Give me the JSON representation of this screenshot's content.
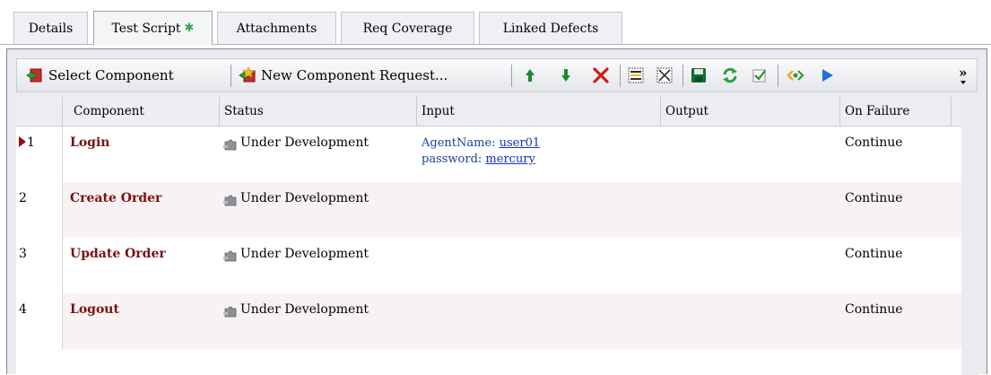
{
  "tabs": [
    {
      "label": "Details",
      "active": false
    },
    {
      "label": "Test Script",
      "active": true,
      "modified_mark": "✱"
    },
    {
      "label": "Attachments",
      "active": false
    },
    {
      "label": "Req Coverage",
      "active": false
    },
    {
      "label": "Linked Defects",
      "active": false
    }
  ],
  "toolbar": {
    "select_component_label": "Select Component",
    "new_component_request_label": "New Component Request...",
    "overflow_glyph": "»"
  },
  "grid": {
    "columns": [
      "Component",
      "Status",
      "Input",
      "Output",
      "On Failure"
    ],
    "rows": [
      {
        "num": "1",
        "component": "Login",
        "status": "Under Development",
        "input": [
          {
            "name": "AgentName: ",
            "value": "user01"
          },
          {
            "name": "password: ",
            "value": "mercury"
          }
        ],
        "output": "",
        "on_failure": "Continue",
        "current": true
      },
      {
        "num": "2",
        "component": "Create Order",
        "status": "Under Development",
        "input": [],
        "output": "",
        "on_failure": "Continue",
        "current": false
      },
      {
        "num": "3",
        "component": "Update Order",
        "status": "Under Development",
        "input": [],
        "output": "",
        "on_failure": "Continue",
        "current": false
      },
      {
        "num": "4",
        "component": "Logout",
        "status": "Under Development",
        "input": [],
        "output": "",
        "on_failure": "Continue",
        "current": false
      }
    ]
  },
  "colors": {
    "component_name": "#7a1212",
    "link": "#1530c8",
    "alt_row": "#f9f2f5",
    "modified_mark": "#3aa84a"
  }
}
